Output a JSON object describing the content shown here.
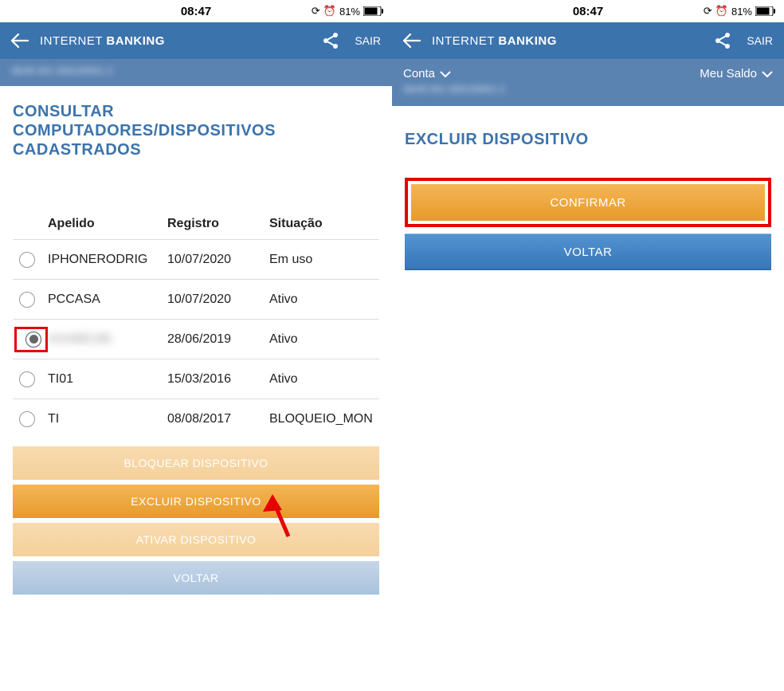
{
  "status": {
    "time": "08:47",
    "battery": "81%"
  },
  "header": {
    "title_light": "INTERNET",
    "title_bold": "BANKING",
    "sair": "SAIR"
  },
  "subheader": {
    "conta_label": "Conta",
    "conta_blur": "06/45 001 000130001·2",
    "saldo_label": "Meu Saldo"
  },
  "left": {
    "title": "CONSULTAR COMPUTADORES/DISPOSITIVOS CADASTRADOS",
    "columns": {
      "apelido": "Apelido",
      "registro": "Registro",
      "situacao": "Situação"
    },
    "rows": [
      {
        "apelido": "IPHONERODRIG",
        "registro": "10/07/2020",
        "situacao": "Em uso",
        "selected": false,
        "blurred": false
      },
      {
        "apelido": "PCCASA",
        "registro": "10/07/2020",
        "situacao": "Ativo",
        "selected": false,
        "blurred": false
      },
      {
        "apelido": "ASABEUBI",
        "registro": "28/06/2019",
        "situacao": "Ativo",
        "selected": true,
        "blurred": true
      },
      {
        "apelido": "TI01",
        "registro": "15/03/2016",
        "situacao": "Ativo",
        "selected": false,
        "blurred": false
      },
      {
        "apelido": "TI",
        "registro": "08/08/2017",
        "situacao": "BLOQUEIO_MON",
        "selected": false,
        "blurred": false
      }
    ],
    "buttons": {
      "bloquear": "BLOQUEAR DISPOSITIVO",
      "excluir": "EXCLUIR DISPOSITIVO",
      "ativar": "ATIVAR DISPOSITIVO",
      "voltar": "VOLTAR"
    }
  },
  "right": {
    "title": "EXCLUIR DISPOSITIVO",
    "buttons": {
      "confirmar": "CONFIRMAR",
      "voltar": "VOLTAR"
    }
  }
}
